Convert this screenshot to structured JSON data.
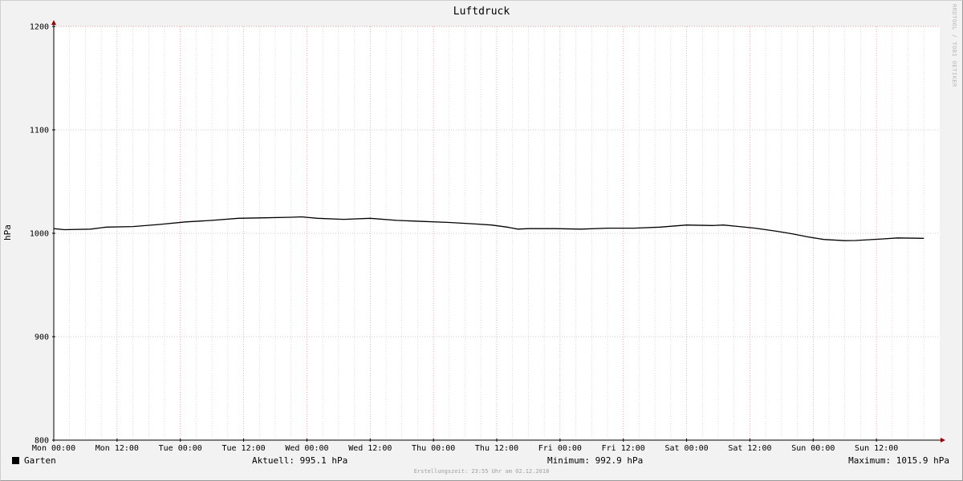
{
  "colors": {
    "background": "#f2f2f2",
    "canvas": "#ffffff",
    "major_grid": "#e08080",
    "minor_grid": "#c8c8c8",
    "line": "#000000",
    "arrow": "#990000"
  },
  "watermark": "RRDTOOL / TOBI OETIKER",
  "legend": {
    "series_name": "Garten",
    "current": "Aktuell: 995.1 hPa",
    "minimum": "Minimum: 992.9 hPa",
    "maximum": "Maximum: 1015.9 hPa"
  },
  "footer": "Erstellungszeit: 23:55 Uhr am 02.12.2018",
  "chart_data": {
    "type": "line",
    "title": "Luftdruck",
    "ylabel": "hPa",
    "xlabel": "",
    "ylim": [
      800,
      1200
    ],
    "xlim": [
      0,
      168
    ],
    "x_unit": "hours since Mon 00:00",
    "yticks": [
      800,
      900,
      1000,
      1100,
      1200
    ],
    "xticks": [
      {
        "x": 0,
        "label": "Mon 00:00"
      },
      {
        "x": 12,
        "label": "Mon 12:00"
      },
      {
        "x": 24,
        "label": "Tue 00:00"
      },
      {
        "x": 36,
        "label": "Tue 12:00"
      },
      {
        "x": 48,
        "label": "Wed 00:00"
      },
      {
        "x": 60,
        "label": "Wed 12:00"
      },
      {
        "x": 72,
        "label": "Thu 00:00"
      },
      {
        "x": 84,
        "label": "Thu 12:00"
      },
      {
        "x": 96,
        "label": "Fri 00:00"
      },
      {
        "x": 108,
        "label": "Fri 12:00"
      },
      {
        "x": 120,
        "label": "Sat 00:00"
      },
      {
        "x": 132,
        "label": "Sat 12:00"
      },
      {
        "x": 144,
        "label": "Sun 00:00"
      },
      {
        "x": 156,
        "label": "Sun 12:00"
      }
    ],
    "grid": true,
    "series": [
      {
        "name": "Garten",
        "x": [
          0,
          2,
          7,
          10,
          15,
          20,
          25,
          30,
          35,
          40,
          45,
          47,
          50,
          55,
          60,
          65,
          70,
          75,
          80,
          83,
          86,
          88,
          90,
          95,
          100,
          105,
          110,
          115,
          120,
          125,
          127,
          130,
          133,
          137,
          140,
          143,
          146,
          150,
          152,
          157,
          160,
          165
        ],
        "y": [
          1004.5,
          1003.5,
          1004,
          1006,
          1006.5,
          1008.5,
          1011,
          1012.5,
          1014.5,
          1015,
          1015.5,
          1015.9,
          1014.5,
          1013.5,
          1014.5,
          1012.5,
          1011.5,
          1010.5,
          1009,
          1008,
          1006,
          1004,
          1004.5,
          1004.5,
          1004,
          1005,
          1005,
          1006,
          1008,
          1007.5,
          1008,
          1006.5,
          1005,
          1002,
          999.5,
          996.5,
          994,
          992.9,
          993,
          994.5,
          995.5,
          995.1
        ]
      }
    ]
  }
}
